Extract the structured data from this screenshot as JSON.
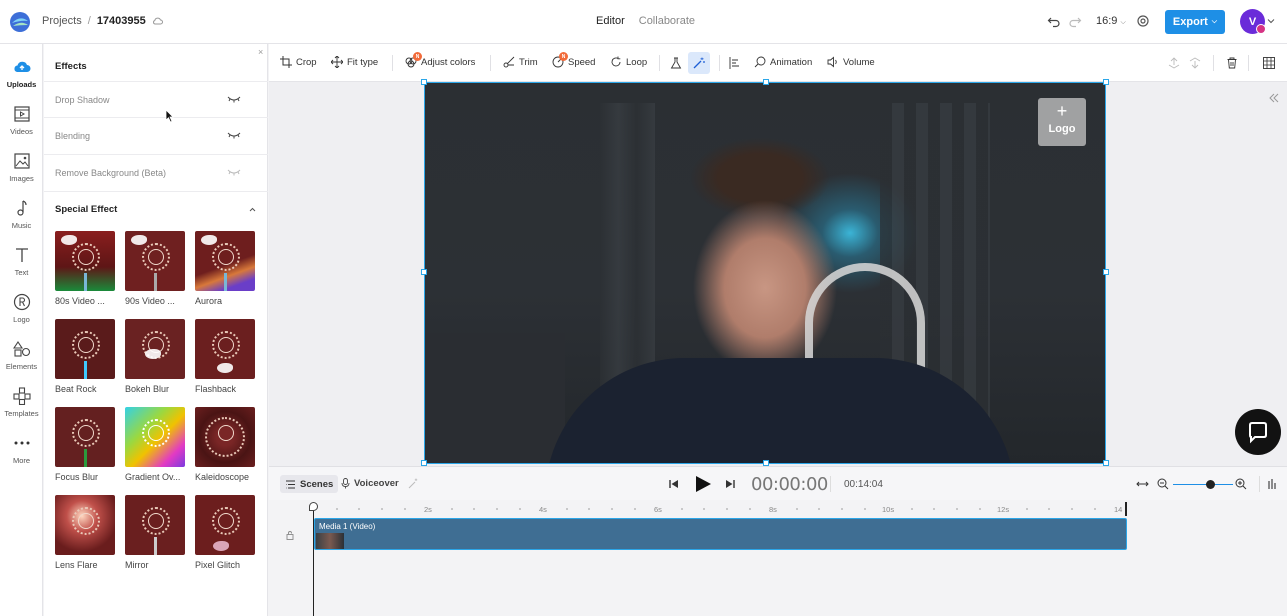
{
  "topbar": {
    "breadcrumb_root": "Projects",
    "breadcrumb_sep": "/",
    "project_id": "17403955",
    "tab_editor": "Editor",
    "tab_collaborate": "Collaborate",
    "aspect_ratio": "16:9",
    "export_label": "Export",
    "avatar_initial": "V",
    "accent_color": "#1e8fe6"
  },
  "rail": {
    "items": [
      {
        "label": "Uploads",
        "icon": "upload-cloud-icon",
        "active": true
      },
      {
        "label": "Videos",
        "icon": "video-frame-icon"
      },
      {
        "label": "Images",
        "icon": "image-icon"
      },
      {
        "label": "Music",
        "icon": "music-note-icon"
      },
      {
        "label": "Text",
        "icon": "text-t-icon"
      },
      {
        "label": "Logo",
        "icon": "registered-icon"
      },
      {
        "label": "Elements",
        "icon": "shapes-icon"
      },
      {
        "label": "Templates",
        "icon": "templates-grid-icon"
      },
      {
        "label": "More",
        "icon": "more-dots-icon"
      }
    ]
  },
  "panel": {
    "close": "×",
    "title": "Effects",
    "effects": [
      {
        "label": "Drop Shadow"
      },
      {
        "label": "Blending"
      },
      {
        "label": "Remove Background (Beta)"
      }
    ],
    "special_title": "Special Effect",
    "special": [
      {
        "label": "80s Video ..."
      },
      {
        "label": "90s Video ..."
      },
      {
        "label": "Aurora"
      },
      {
        "label": "Beat Rock"
      },
      {
        "label": "Bokeh Blur"
      },
      {
        "label": "Flashback"
      },
      {
        "label": "Focus Blur"
      },
      {
        "label": "Gradient Ov..."
      },
      {
        "label": "Kaleidoscope"
      },
      {
        "label": "Lens Flare"
      },
      {
        "label": "Mirror"
      },
      {
        "label": "Pixel Glitch"
      }
    ]
  },
  "toolbar": {
    "crop": "Crop",
    "fit_type": "Fit type",
    "adjust_colors": "Adjust colors",
    "trim": "Trim",
    "speed": "Speed",
    "loop": "Loop",
    "animation": "Animation",
    "volume": "Volume",
    "badge_text": "N"
  },
  "canvas": {
    "logo_plus": "+",
    "logo_label": "Logo"
  },
  "playback": {
    "scenes": "Scenes",
    "voiceover": "Voiceover",
    "current_time": "00:00:00",
    "total_time": "00:14:04"
  },
  "timeline": {
    "ticks": [
      "2s",
      "4s",
      "6s",
      "8s",
      "10s",
      "12s",
      "14"
    ],
    "clip_label": "Media 1 (Video)"
  }
}
